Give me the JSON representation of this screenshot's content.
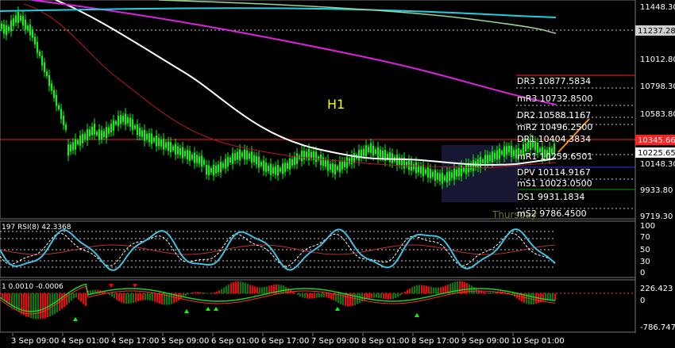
{
  "chart": {
    "timeframe": "H1",
    "watermark": "Thursday",
    "colors": {
      "background": "#000000",
      "candle": "#00ff00",
      "ma_cyan": "#1fd1e0",
      "ma_green": "#9bd39b",
      "ma_magenta": "#e020e0",
      "ma_white": "#ffffff",
      "ma_red": "#c01818",
      "level_line": "#c8c8c8",
      "red_line": "#ff2020",
      "blue_line": "#2020ff",
      "box": "#202040",
      "orange": "#ff8c00",
      "macd_pos": "#008000",
      "macd_neg": "#ff0000"
    }
  },
  "price_axis": {
    "ticks": [
      "11448.30",
      "11012.80",
      "10798.30",
      "10583.80",
      "10148.30",
      "9933.80",
      "9719.30"
    ],
    "label_top": "11237.28",
    "label_red": "10345.66",
    "label_current": "10225.65"
  },
  "levels": [
    {
      "name": "DR3",
      "value": "10877.5834"
    },
    {
      "name": "mR3",
      "value": "10732.8500"
    },
    {
      "name": "DR2",
      "value": "10588.1167"
    },
    {
      "name": "mR2",
      "value": "10496.2500"
    },
    {
      "name": "DR1",
      "value": "10404.3834"
    },
    {
      "name": "mR1",
      "value": "10259.6501"
    },
    {
      "name": "DPV",
      "value": "10114.9167"
    },
    {
      "name": "mS1",
      "value": "10023.0500"
    },
    {
      "name": "DS1",
      "value": "9931.1834"
    },
    {
      "name": "mS2",
      "value": "9786.4500"
    }
  ],
  "rsi": {
    "label": "197  RSI(8) 42.3368",
    "ticks": [
      "100",
      "70",
      "50",
      "30",
      "0"
    ]
  },
  "macd": {
    "label": "1  0.0010  -0.0006",
    "ticks": [
      "226.423",
      "0",
      "-786.747"
    ]
  },
  "time_axis": [
    "3 Sep 09:00",
    "4 Sep 01:00",
    "4 Sep 17:00",
    "5 Sep 09:00",
    "6 Sep 01:00",
    "6 Sep 17:00",
    "7 Sep 09:00",
    "8 Sep 01:00",
    "8 Sep 17:00",
    "9 Sep 09:00",
    "10 Sep 01:00"
  ]
}
